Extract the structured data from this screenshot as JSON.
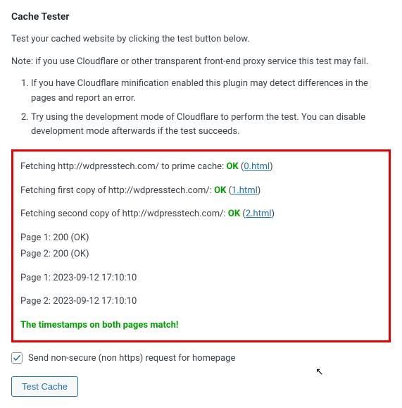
{
  "heading": "Cache Tester",
  "intro": "Test your cached website by clicking the test button below.",
  "note": "Note: if you use Cloudflare or other transparent front-end proxy service this test may fail.",
  "tips": [
    "If you have Cloudflare minification enabled this plugin may detect differences in the pages and report an error.",
    "Try using the development mode of Cloudflare to perform the test. You can disable development mode afterwards if the test succeeds."
  ],
  "results": {
    "fetch_prime_prefix": "Fetching http://wdpresstech.com/ to prime cache: ",
    "fetch_prime_status": "OK",
    "fetch_prime_link": "0.html",
    "fetch_first_prefix": "Fetching first copy of http://wdpresstech.com/: ",
    "fetch_first_status": "OK",
    "fetch_first_link": "1.html",
    "fetch_second_prefix": "Fetching second copy of http://wdpresstech.com/: ",
    "fetch_second_status": "OK",
    "fetch_second_link": "2.html",
    "page1_status": "Page 1: 200 (OK)",
    "page2_status": "Page 2: 200 (OK)",
    "page1_ts": "Page 1: 2023-09-12 17:10:10",
    "page2_ts": "Page 2: 2023-09-12 17:10:10",
    "match_msg": "The timestamps on both pages match!"
  },
  "checkbox_label": "Send non-secure (non https) request for homepage",
  "button_label": "Test Cache"
}
